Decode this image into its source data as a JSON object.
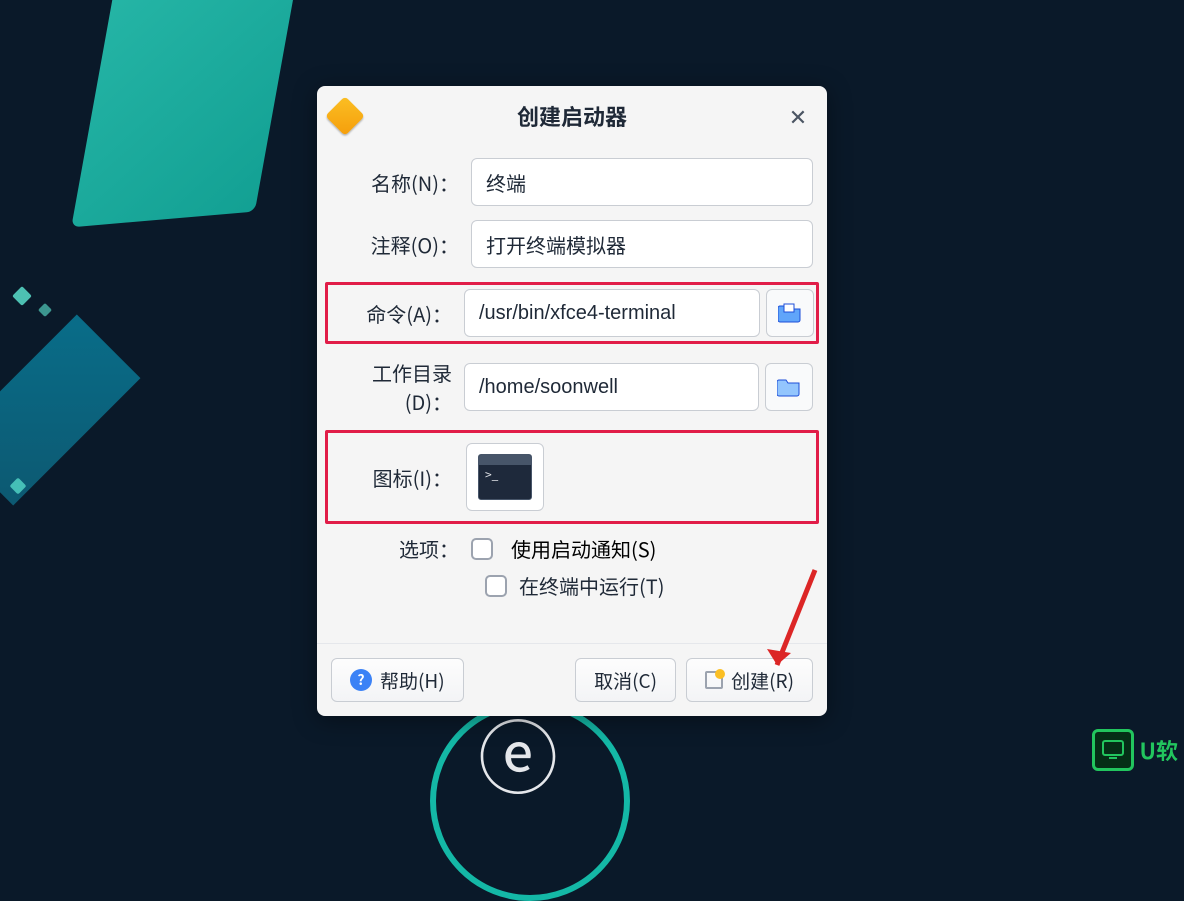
{
  "dialog": {
    "title": "创建启动器",
    "fields": {
      "name": {
        "label": "名称(N)：",
        "value": "终端"
      },
      "comment": {
        "label": "注释(O)：",
        "value": "打开终端模拟器"
      },
      "command": {
        "label": "命令(A)：",
        "value": "/usr/bin/xfce4-terminal"
      },
      "workdir": {
        "label": "工作目录(D)：",
        "value": "/home/soonwell"
      },
      "icon": {
        "label": "图标(I)："
      },
      "options_label": "选项：",
      "opt_startup": "使用启动通知(S)",
      "opt_terminal": "在终端中运行(T)"
    },
    "buttons": {
      "help": "帮助(H)",
      "cancel": "取消(C)",
      "create": "创建(R)"
    }
  },
  "watermark": "U软"
}
